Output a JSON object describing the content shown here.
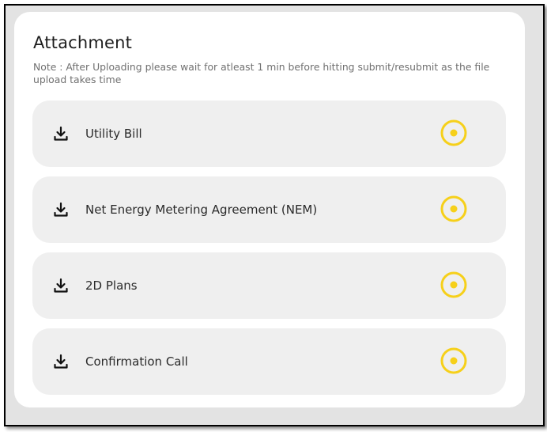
{
  "panel": {
    "title": "Attachment",
    "note": "Note : After Uploading please wait for atleast 1 min before hitting submit/resubmit as the file upload takes time"
  },
  "attachments": [
    {
      "label": "Utility Bill",
      "icon": "download-icon",
      "status_icon": "pending-radio-icon"
    },
    {
      "label": "Net Energy Metering Agreement (NEM)",
      "icon": "download-icon",
      "status_icon": "pending-radio-icon"
    },
    {
      "label": "2D Plans",
      "icon": "download-icon",
      "status_icon": "pending-radio-icon"
    },
    {
      "label": "Confirmation Call",
      "icon": "download-icon",
      "status_icon": "pending-radio-icon"
    }
  ],
  "colors": {
    "status_accent": "#f6d01a",
    "item_background": "#efefef",
    "frame_background": "#e3e3e3"
  }
}
